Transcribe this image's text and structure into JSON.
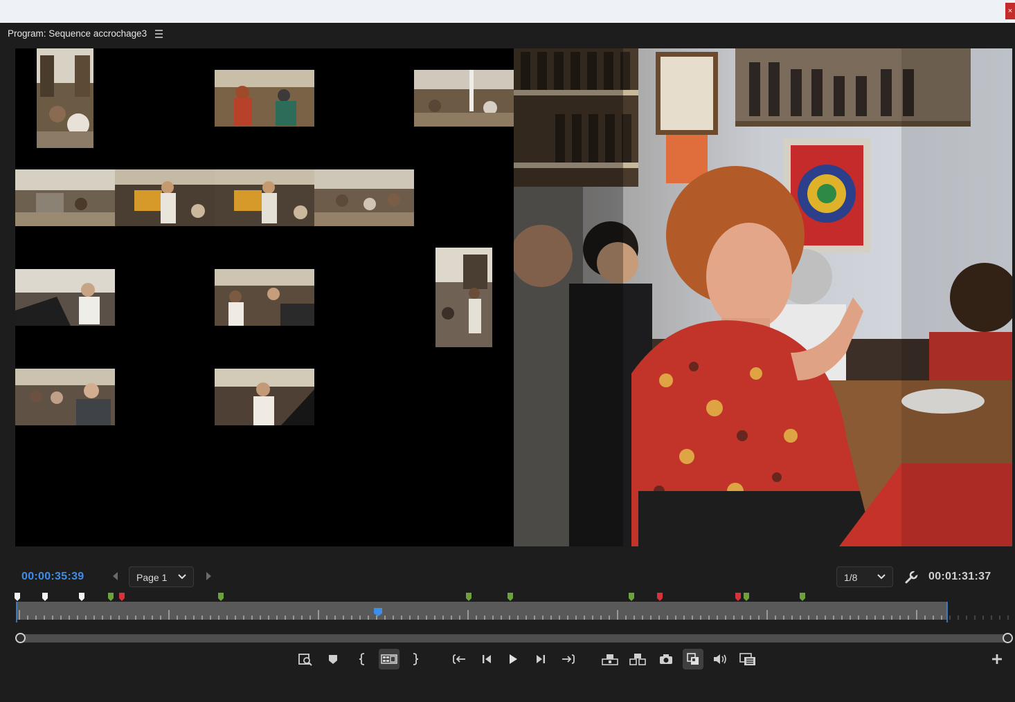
{
  "window": {
    "close_glyph": "×"
  },
  "panel": {
    "title": "Program: Sequence accrochage3",
    "menu_icon": "hamburger-icon"
  },
  "viewer": {
    "grid_thumbnails": 12,
    "selected_thumbnail": 2
  },
  "controls": {
    "current_timecode": "00:00:35:39",
    "duration_timecode": "00:01:31:37",
    "page_label": "Page 1",
    "zoom_label": "1/8"
  },
  "colors": {
    "accent_timecode": "#3d8ee8",
    "selected_outline": "#e6e02a",
    "marker_white": "#f2f2f2",
    "marker_green": "#6da23a",
    "marker_red": "#d6323a",
    "playhead": "#3d8ee8"
  },
  "markers": [
    {
      "color": "white"
    },
    {
      "color": "white"
    },
    {
      "color": "white"
    },
    {
      "color": "green"
    },
    {
      "color": "red"
    },
    {
      "color": "green"
    },
    {
      "color": "green"
    },
    {
      "color": "green"
    },
    {
      "color": "green"
    },
    {
      "color": "red"
    },
    {
      "color": "red"
    },
    {
      "color": "green"
    },
    {
      "color": "green"
    }
  ],
  "transport_buttons": [
    {
      "name": "add-marker-magnifier-button",
      "icon": "zoom-frame-icon"
    },
    {
      "name": "add-marker-button",
      "icon": "marker-icon"
    },
    {
      "name": "mark-in-button",
      "icon": "mark-in-icon"
    },
    {
      "name": "multicam-toggle-button",
      "icon": "multicam-icon",
      "active": true
    },
    {
      "name": "mark-out-button",
      "icon": "mark-out-icon"
    },
    {
      "name": "go-to-in-button",
      "icon": "go-to-in-icon"
    },
    {
      "name": "step-back-button",
      "icon": "step-back-icon"
    },
    {
      "name": "play-button",
      "icon": "play-icon"
    },
    {
      "name": "step-forward-button",
      "icon": "step-forward-icon"
    },
    {
      "name": "go-to-out-button",
      "icon": "go-to-out-icon"
    },
    {
      "name": "lift-button",
      "icon": "lift-icon"
    },
    {
      "name": "extract-button",
      "icon": "extract-icon"
    },
    {
      "name": "export-frame-button",
      "icon": "camera-icon"
    },
    {
      "name": "comparison-view-button",
      "icon": "comparison-icon",
      "active": true
    },
    {
      "name": "volume-button",
      "icon": "speaker-icon"
    },
    {
      "name": "safe-margins-button",
      "icon": "safe-margins-icon"
    },
    {
      "name": "button-editor-button",
      "icon": "plus-icon"
    }
  ]
}
